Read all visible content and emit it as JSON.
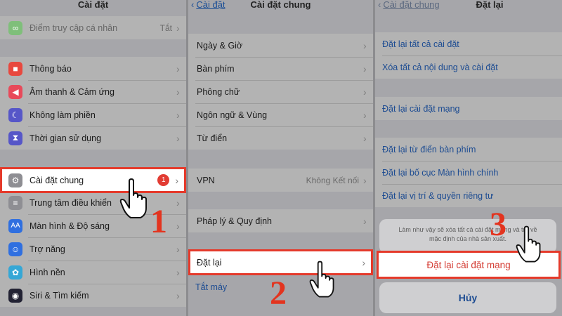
{
  "panel1": {
    "title": "Cài đặt",
    "top_row": {
      "label": "Điểm truy cập cá nhân",
      "value": "Tắt"
    },
    "group2": [
      {
        "label": "Thông báo",
        "icon": "notification-icon",
        "color": "#e8483e"
      },
      {
        "label": "Âm thanh & Cảm ứng",
        "icon": "sound-icon",
        "color": "#e84a5a"
      },
      {
        "label": "Không làm phiền",
        "icon": "moon-icon",
        "color": "#5656c8"
      },
      {
        "label": "Thời gian sử dụng",
        "icon": "hourglass-icon",
        "color": "#5656c8"
      }
    ],
    "general": {
      "label": "Cài đặt chung",
      "badge": "1"
    },
    "group3": [
      {
        "label": "Trung tâm điều khiển",
        "icon": "control-center-icon",
        "color": "#8e8e93"
      },
      {
        "label": "Màn hình & Độ sáng",
        "icon": "display-icon",
        "color": "#2f6fe0"
      },
      {
        "label": "Trợ năng",
        "icon": "accessibility-icon",
        "color": "#2f6fe0"
      },
      {
        "label": "Hình nền",
        "icon": "wallpaper-icon",
        "color": "#35a7d6"
      },
      {
        "label": "Siri & Tìm kiếm",
        "icon": "siri-icon",
        "color": "#222233"
      }
    ],
    "step_number": "1"
  },
  "panel2": {
    "back_label": "Cài đặt",
    "title": "Cài đặt chung",
    "group1": [
      "Ngày & Giờ",
      "Bàn phím",
      "Phông chữ",
      "Ngôn ngữ & Vùng",
      "Từ điển"
    ],
    "vpn": {
      "label": "VPN",
      "value": "Không Kết nối"
    },
    "legal": "Pháp lý & Quy định",
    "reset": "Đặt lại",
    "shutdown": "Tắt máy",
    "step_number": "2"
  },
  "panel3": {
    "back_label": "Cài đặt chung",
    "title": "Đặt lại",
    "group1": [
      "Đặt lại tất cả cài đặt",
      "Xóa tất cả nội dung và cài đặt"
    ],
    "group2": [
      "Đặt lại cài đặt mạng"
    ],
    "group3": [
      "Đặt lại từ điển bàn phím",
      "Đặt lại bố cục Màn hình chính",
      "Đặt lại vị trí & quyền riêng tư"
    ],
    "sheet": {
      "message": "Làm như vậy sẽ xóa tất cả cài đặt mạng và trả về mặc định của nhà sản xuất.",
      "confirm": "Đặt lại cài đặt mạng",
      "cancel": "Hủy"
    },
    "step_number": "3"
  }
}
